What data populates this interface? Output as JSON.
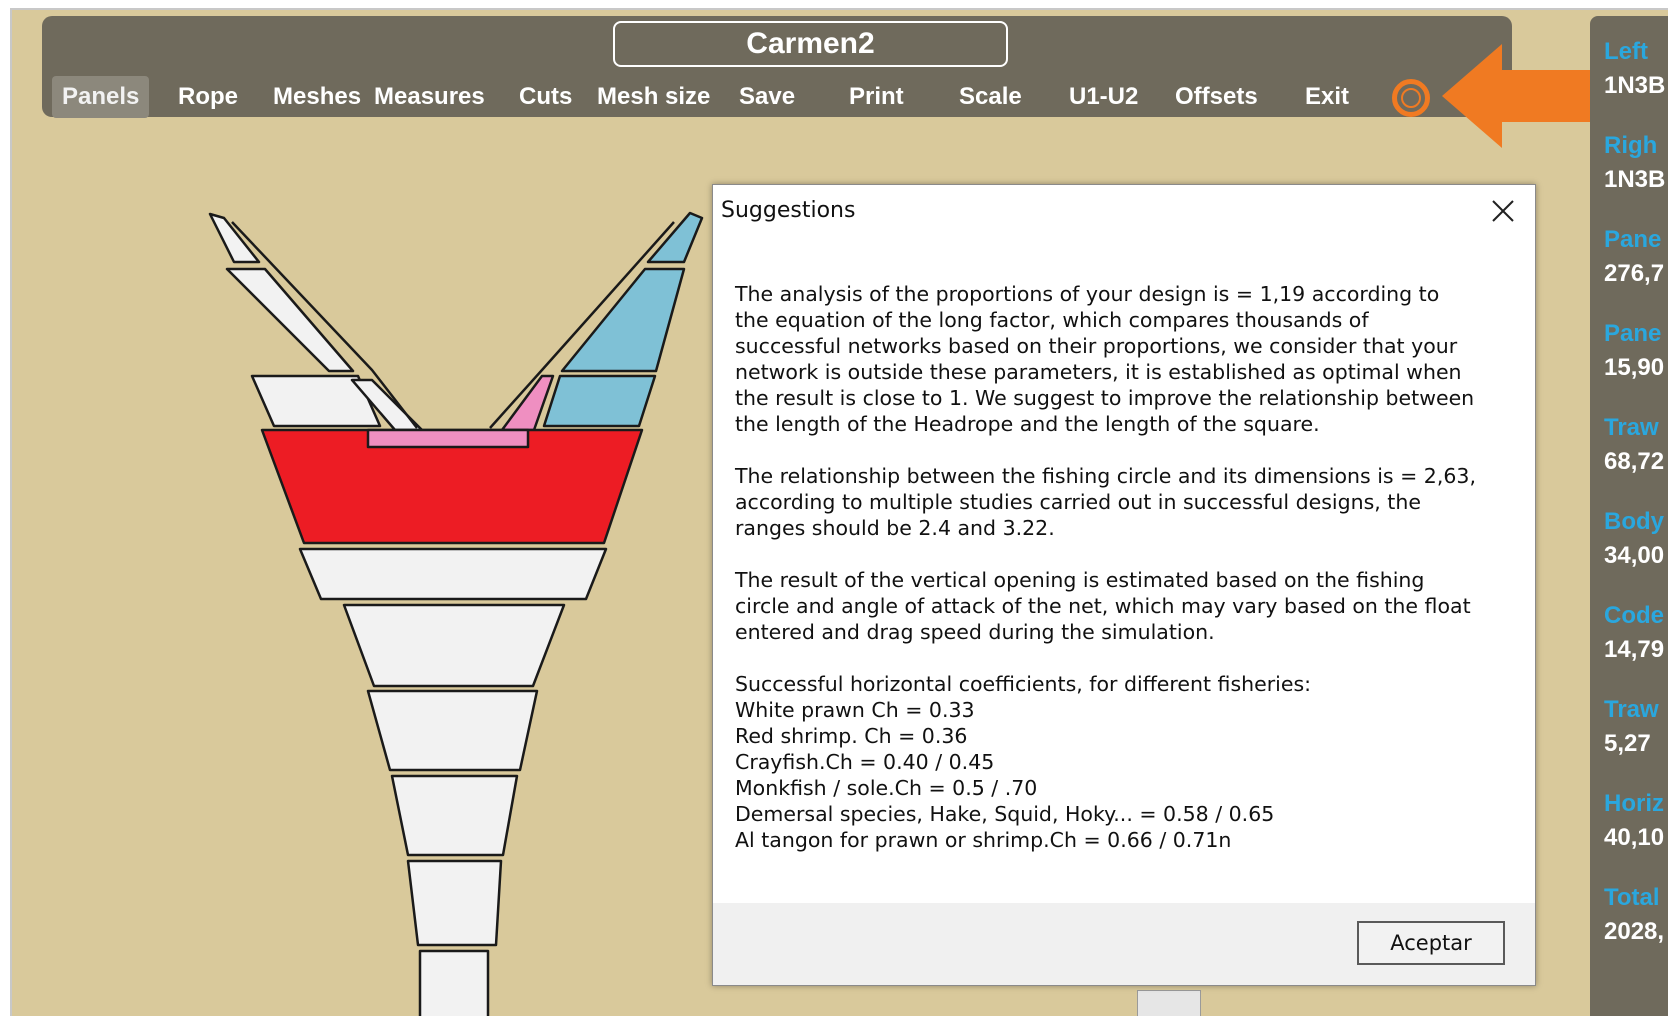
{
  "window": {
    "title": "Carmen2"
  },
  "menu": {
    "items": [
      "Panels",
      "Rope",
      "Meshes",
      "Measures",
      "Cuts",
      "Mesh size",
      "Save",
      "Print",
      "Scale",
      "U1-U2",
      "Offsets",
      "Exit"
    ],
    "active": "Panels"
  },
  "right_panel": {
    "entries": [
      {
        "label": "Left",
        "value": "1N3B"
      },
      {
        "label": "Righ",
        "value": "1N3B"
      },
      {
        "label": "Pane",
        "value": "276,7"
      },
      {
        "label": "Pane",
        "value": "15,90"
      },
      {
        "label": "Traw",
        "value": "68,72"
      },
      {
        "label": "Body",
        "value": "34,00"
      },
      {
        "label": "Code",
        "value": "14,79"
      },
      {
        "label": "Traw",
        "value": "5,27"
      },
      {
        "label": "Horiz",
        "value": "40,10"
      },
      {
        "label": "Total",
        "value": "2028,"
      }
    ]
  },
  "dialog": {
    "title": "Suggestions",
    "paragraphs": [
      [
        "The analysis of the proportions of your design is = 1,19 according to",
        "the equation of the long factor, which compares thousands of",
        "successful networks based on their proportions, we consider that your",
        "network is outside these parameters, it is established as optimal when",
        "the result is close to 1. We suggest to improve the relationship between",
        "the length of the Headrope and the length of the square."
      ],
      [
        "The relationship between the fishing circle and its dimensions is = 2,63,",
        "according to multiple studies carried out in successful designs, the",
        "ranges should be 2.4 and 3.22."
      ],
      [
        "The result of the vertical opening is estimated based on the fishing",
        "circle and angle of attack of the net, which may vary based on the float",
        "entered and drag speed during the simulation."
      ],
      [
        "Successful horizontal coefficients, for different fisheries:",
        "White prawn Ch = 0.33",
        "Red shrimp. Ch = 0.36",
        "Crayfish.Ch = 0.40 / 0.45",
        "Monkfish / sole.Ch = 0.5 / .70",
        "Demersal species, Hake, Squid, Hoky... = 0.58 / 0.65",
        "Al tangon for prawn or shrimp.Ch = 0.66 / 0.71n"
      ]
    ],
    "accept_label": "Aceptar"
  },
  "colors": {
    "background": "#d9c99b",
    "toolbar": "#6f6a5c",
    "panel_label": "#2aa7de",
    "accent_orange": "#f07a22",
    "net_red": "#ed1c24",
    "net_blue": "#7fc1d6",
    "net_pink": "#ef8fc1",
    "net_white": "#f2f2f2"
  },
  "icons": {
    "close": "close-icon",
    "arrow": "orange-arrow-icon",
    "marker": "target-ring-icon"
  }
}
